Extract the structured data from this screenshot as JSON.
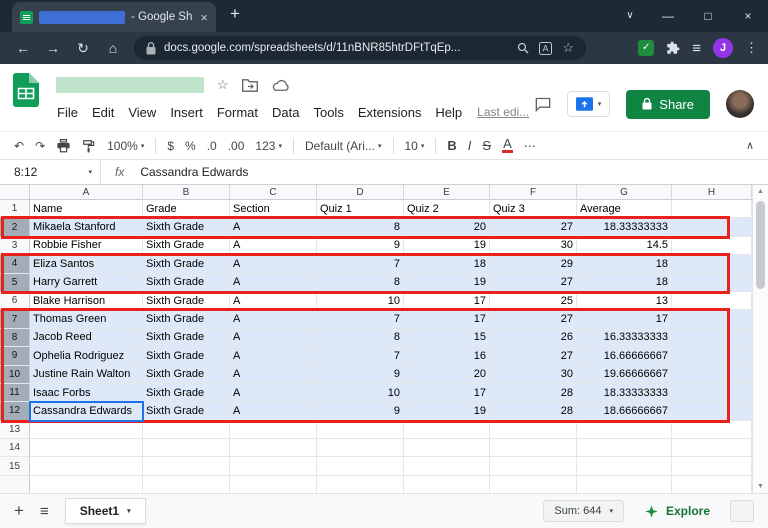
{
  "icons": {
    "plus": "+",
    "close": "×",
    "minimize": "—",
    "maximize": "□",
    "chevron": "∨",
    "back": "←",
    "forward": "→",
    "reload": "↻",
    "home": "⌂",
    "star": "☆",
    "check": "✓",
    "hamburger": "≡",
    "kebab": "⋮",
    "more": "⋯",
    "undo": "↶",
    "redo": "↷",
    "caret": "▾",
    "collapse": "∧",
    "up": "▲",
    "down": "▼"
  },
  "colors": {
    "selection_fill": "#dde9f9",
    "annotation_red": "#e8221a",
    "share_green": "#0f8443",
    "sheets_green": "#0f9d58",
    "active_cell_blue": "#1a73e8"
  },
  "titlebar": {
    "tab_title_suffix": "- Google Sh"
  },
  "navbar": {
    "url": "docs.google.com/spreadsheets/d/11nBNR85htrDFtTqEp...",
    "profile_initial": "J"
  },
  "header": {
    "menus": [
      "File",
      "Edit",
      "View",
      "Insert",
      "Format",
      "Data",
      "Tools",
      "Extensions",
      "Help"
    ],
    "last_edit_label": "Last edi...",
    "share_label": "Share"
  },
  "toolbar": {
    "zoom": "100%",
    "currency": "$",
    "percent": "%",
    "decrease_decimal": ".0",
    "increase_decimal": ".00",
    "more_formats": "123",
    "font_name": "Default (Ari...",
    "font_size": "10",
    "bold": "B",
    "italic": "I",
    "strikethrough": "S",
    "text_color": "A"
  },
  "formula_bar": {
    "name_box": "8:12",
    "fx_label": "fx",
    "value": "Cassandra Edwards"
  },
  "grid": {
    "columns": [
      "A",
      "B",
      "C",
      "D",
      "E",
      "F",
      "G",
      "H"
    ],
    "rows": [
      {
        "n": 1,
        "cells": [
          "Name",
          "Grade",
          "Section",
          "Quiz 1",
          "Quiz 2",
          "Quiz 3",
          "Average",
          ""
        ]
      },
      {
        "n": 2,
        "cells": [
          "Mikaela Stanford",
          "Sixth Grade",
          "A",
          "8",
          "20",
          "27",
          "18.33333333",
          ""
        ]
      },
      {
        "n": 3,
        "cells": [
          "Robbie Fisher",
          "Sixth Grade",
          "A",
          "9",
          "19",
          "30",
          "14.5",
          ""
        ]
      },
      {
        "n": 4,
        "cells": [
          "Eliza Santos",
          "Sixth Grade",
          "A",
          "7",
          "18",
          "29",
          "18",
          ""
        ]
      },
      {
        "n": 5,
        "cells": [
          "Harry Garrett",
          "Sixth Grade",
          "A",
          "8",
          "19",
          "27",
          "18",
          ""
        ]
      },
      {
        "n": 6,
        "cells": [
          "Blake Harrison",
          "Sixth Grade",
          "A",
          "10",
          "17",
          "25",
          "13",
          ""
        ]
      },
      {
        "n": 7,
        "cells": [
          "Thomas Green",
          "Sixth Grade",
          "A",
          "7",
          "17",
          "27",
          "17",
          ""
        ]
      },
      {
        "n": 8,
        "cells": [
          "Jacob Reed",
          "Sixth Grade",
          "A",
          "8",
          "15",
          "26",
          "16.33333333",
          ""
        ]
      },
      {
        "n": 9,
        "cells": [
          "Ophelia Rodriguez",
          "Sixth Grade",
          "A",
          "7",
          "16",
          "27",
          "16.66666667",
          ""
        ]
      },
      {
        "n": 10,
        "cells": [
          "Justine Rain Walton",
          "Sixth Grade",
          "A",
          "9",
          "20",
          "30",
          "19.66666667",
          ""
        ]
      },
      {
        "n": 11,
        "cells": [
          "Isaac Forbs",
          "Sixth Grade",
          "A",
          "10",
          "17",
          "28",
          "18.33333333",
          ""
        ]
      },
      {
        "n": 12,
        "cells": [
          "Cassandra Edwards",
          "Sixth Grade",
          "A",
          "9",
          "19",
          "28",
          "18.66666667",
          ""
        ]
      },
      {
        "n": 13,
        "cells": [
          "",
          "",
          "",
          "",
          "",
          "",
          "",
          ""
        ]
      },
      {
        "n": 14,
        "cells": [
          "",
          "",
          "",
          "",
          "",
          "",
          "",
          ""
        ]
      },
      {
        "n": 15,
        "cells": [
          "",
          "",
          "",
          "",
          "",
          "",
          "",
          ""
        ]
      }
    ],
    "selected_rows": [
      2,
      4,
      5,
      7,
      8,
      9,
      10,
      11,
      12
    ],
    "red_boxes": [
      {
        "from_row": 2,
        "to_row": 2
      },
      {
        "from_row": 4,
        "to_row": 5
      },
      {
        "from_row": 7,
        "to_row": 12
      }
    ],
    "active_cell": {
      "row": 12,
      "column": "A"
    }
  },
  "bottom_bar": {
    "sheet_tab_label": "Sheet1",
    "sum_label": "Sum: 644",
    "explore_label": "Explore"
  }
}
